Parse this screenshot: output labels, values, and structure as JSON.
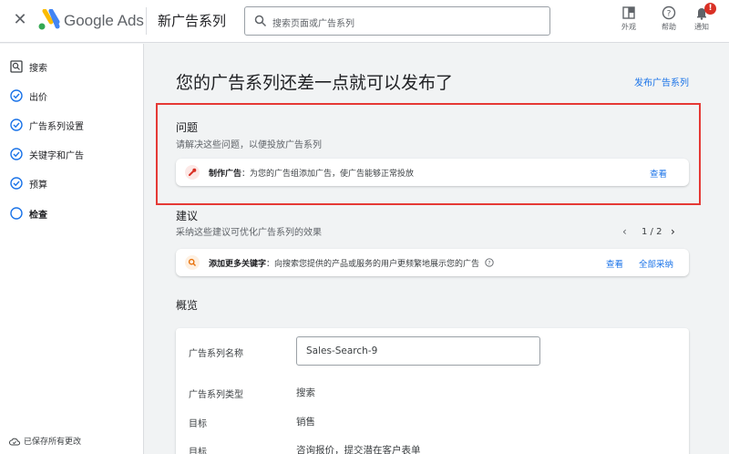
{
  "header": {
    "brand": "Google Ads",
    "page_title": "新广告系列",
    "search_placeholder": "搜索页面或广告系列",
    "tools": [
      {
        "label": "外观",
        "icon": "appearance-icon"
      },
      {
        "label": "帮助",
        "icon": "help-icon"
      },
      {
        "label": "通知",
        "icon": "notifications-icon",
        "badge": "!"
      }
    ]
  },
  "sidebar": {
    "items": [
      {
        "label": "搜索",
        "icon": "search-campaign-icon",
        "state": "page"
      },
      {
        "label": "出价",
        "icon": "check-circle-icon",
        "state": "done"
      },
      {
        "label": "广告系列设置",
        "icon": "check-circle-icon",
        "state": "done"
      },
      {
        "label": "关键字和广告",
        "icon": "check-circle-icon",
        "state": "done"
      },
      {
        "label": "预算",
        "icon": "check-circle-icon",
        "state": "done"
      },
      {
        "label": "检查",
        "icon": "open-circle-icon",
        "state": "active"
      }
    ],
    "saved_status": "已保存所有更改"
  },
  "main": {
    "headline": "您的广告系列还差一点就可以发布了",
    "publish_link": "发布广告系列",
    "issues": {
      "title": "问题",
      "subtitle": "请解决这些问题，以便投放广告系列",
      "item": {
        "bold": "制作广告",
        "text": "：为您的广告组添加广告，使广告能够正常投放",
        "action": "查看"
      }
    },
    "suggestions": {
      "title": "建议",
      "subtitle": "采纳这些建议可优化广告系列的效果",
      "pager": "1 / 2",
      "item": {
        "bold": "添加更多关键字",
        "text": "：向搜索您提供的产品或服务的用户更频繁地展示您的广告",
        "action_view": "查看",
        "action_apply": "全部采纳"
      }
    },
    "overview": {
      "title": "概览",
      "campaign_name_label": "广告系列名称",
      "campaign_name_value": "Sales-Search-9",
      "campaign_type_label": "广告系列类型",
      "campaign_type_value": "搜索",
      "goal_label": "目标",
      "goal_value": "销售",
      "goal2_label": "目标",
      "goal2_value": "咨询报价，提交潜在客户表单"
    }
  },
  "colors": {
    "accent": "#1a73e8",
    "highlight_border": "#e53935",
    "issue_icon": "#d93025",
    "suggestion_icon": "#e8710a"
  }
}
